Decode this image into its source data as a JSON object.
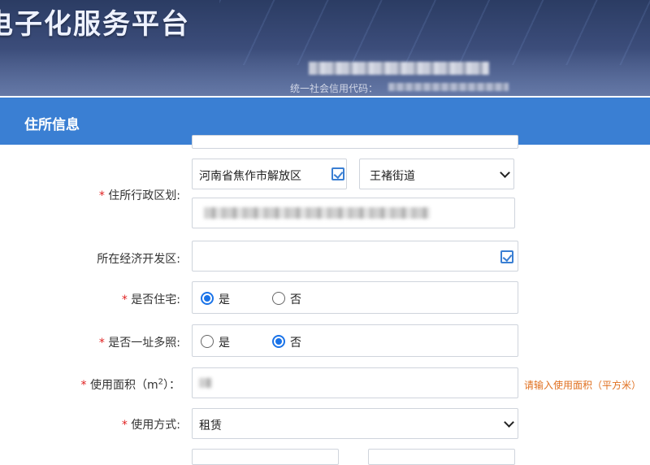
{
  "header": {
    "platform_title": "电子化服务平台",
    "credit_code_label": "统一社会信用代码："
  },
  "section": {
    "title": "住所信息"
  },
  "form": {
    "admin_region": {
      "label": "住所行政区划:",
      "required_mark": "*",
      "region_value": "河南省焦作市解放区",
      "street_value": "王褚街道"
    },
    "dev_zone": {
      "label": "所在经济开发区:",
      "value": ""
    },
    "is_residence": {
      "required_mark": "*",
      "label": "是否住宅:",
      "options": [
        "是",
        "否"
      ],
      "selected": "是"
    },
    "multi_license": {
      "required_mark": "*",
      "label": "是否一址多照:",
      "options": [
        "是",
        "否"
      ],
      "selected": "否"
    },
    "usage_area": {
      "required_mark": "*",
      "label_prefix": "使用面积（m",
      "label_sup": "2",
      "label_suffix": "）：",
      "hint": "请输入使用面积（平方米）"
    },
    "usage_type": {
      "required_mark": "*",
      "label": "使用方式:",
      "value": "租赁"
    }
  },
  "icons": {
    "picker": "checkbox-picker-icon",
    "dropdown": "chevron-down-icon",
    "accent_color": "#3a7fd3",
    "radio_color": "#1a73e8",
    "hint_color": "#e07020"
  }
}
